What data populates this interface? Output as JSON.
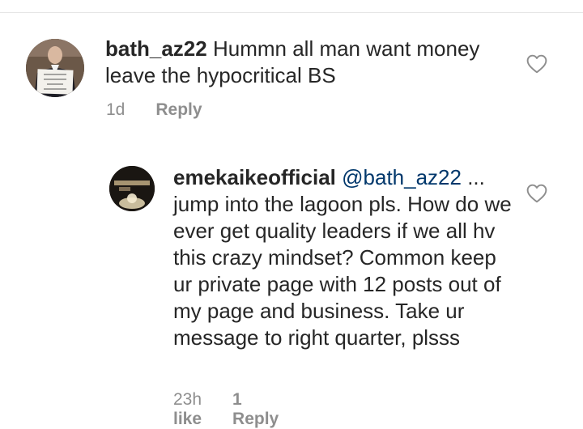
{
  "comments": [
    {
      "username": "bath_az22",
      "text": "Hummn all man want money leave the hypocritical BS",
      "time": "1d",
      "reply_label": "Reply",
      "avatar_sign_lines": [
        "I want to",
        "make money",
        "bitcoin",
        "want to be a",
        "trader"
      ]
    },
    {
      "username": "emekaikeofficial",
      "mention": "@bath_az22",
      "text": " ... jump into the lagoon pls. How do we ever get quality leaders if we all hv this crazy mindset? Common keep ur private page with 12 posts out of my page and business. Take ur message to right quarter,  plsss",
      "time": "23h",
      "likes": "1 like",
      "reply_label": "Reply"
    }
  ],
  "icons": {
    "like": "heart-outline-icon"
  }
}
